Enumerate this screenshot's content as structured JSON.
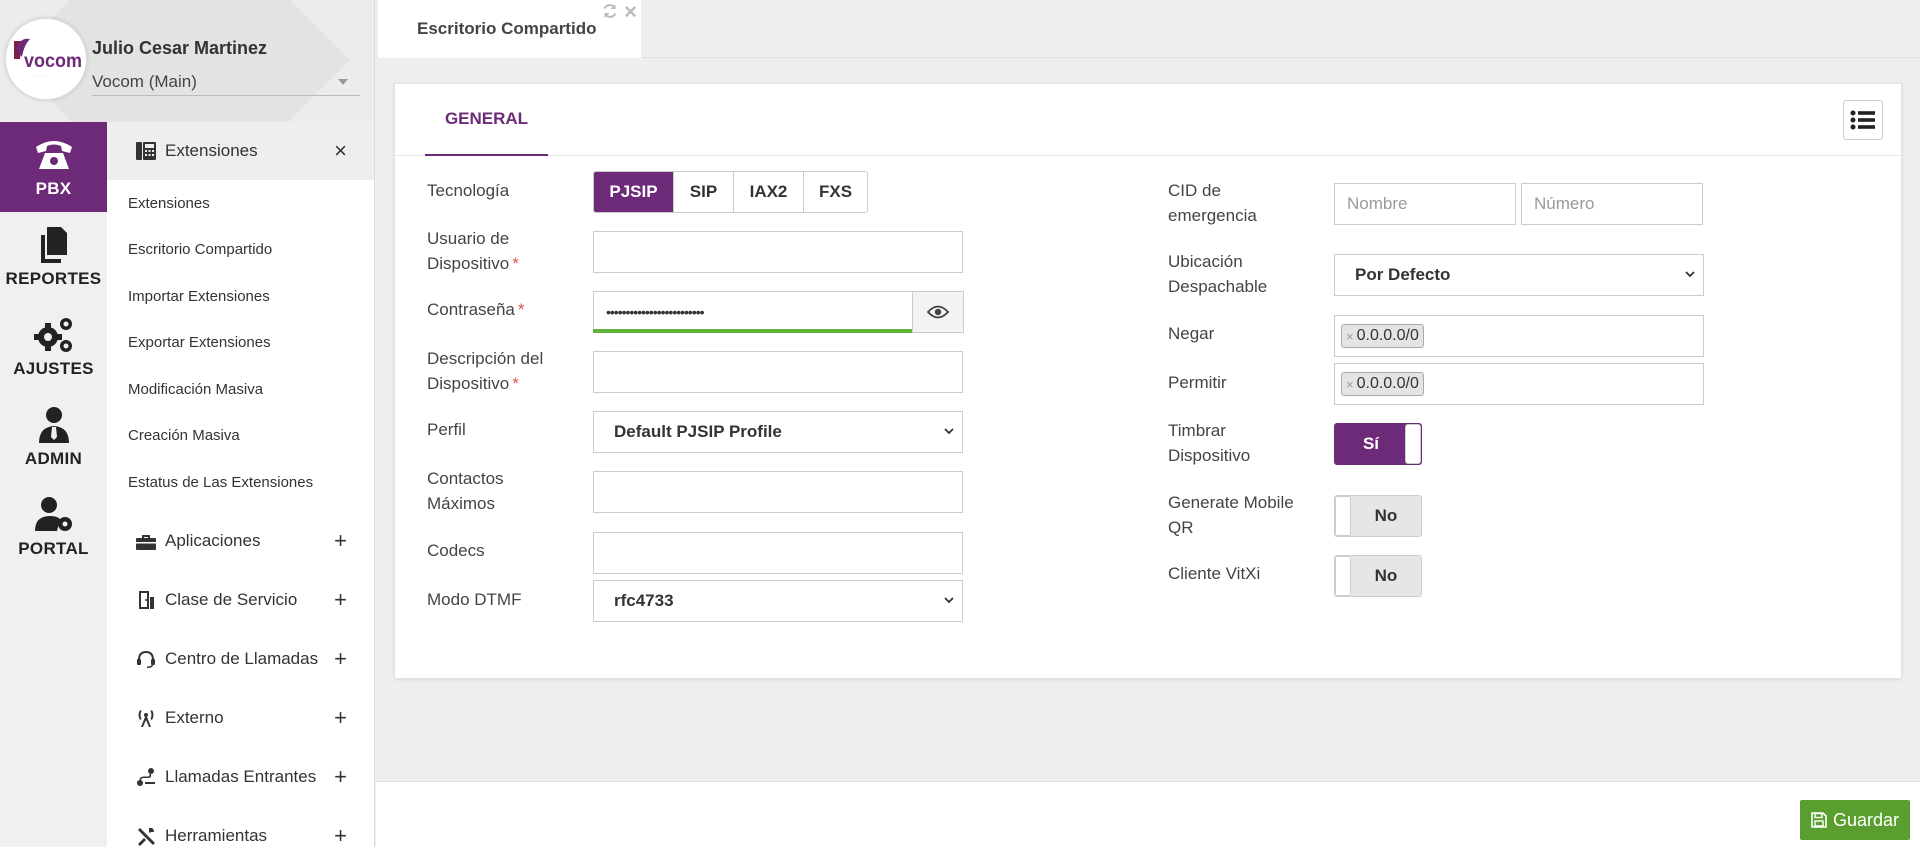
{
  "user": {
    "name": "Julio Cesar Martinez",
    "tenant": "Vocom (Main)",
    "logo_text": "vocom"
  },
  "rail": [
    {
      "label": "PBX",
      "icon": "phone-icon",
      "active": true
    },
    {
      "label": "REPORTES",
      "icon": "documents-icon",
      "active": false
    },
    {
      "label": "AJUSTES",
      "icon": "gears-icon",
      "active": false
    },
    {
      "label": "ADMIN",
      "icon": "admin-user-icon",
      "active": false
    },
    {
      "label": "PORTAL",
      "icon": "user-gear-icon",
      "active": false
    }
  ],
  "submenu": {
    "open_group": {
      "label": "Extensiones",
      "icon": "pbx-extension-icon",
      "toggle": "×"
    },
    "links": [
      "Extensiones",
      "Escritorio Compartido",
      "Importar Extensiones",
      "Exportar Extensiones",
      "Modificación Masiva",
      "Creación Masiva",
      "Estatus de Las Extensiones"
    ],
    "groups": [
      {
        "label": "Aplicaciones",
        "icon": "toolbox-icon",
        "toggle": "+"
      },
      {
        "label": "Clase de Servicio",
        "icon": "door-icon",
        "toggle": "+"
      },
      {
        "label": "Centro de Llamadas",
        "icon": "headset-icon",
        "toggle": "+"
      },
      {
        "label": "Externo",
        "icon": "antenna-icon",
        "toggle": "+"
      },
      {
        "label": "Llamadas Entrantes",
        "icon": "route-icon",
        "toggle": "+"
      },
      {
        "label": "Herramientas",
        "icon": "tools-icon",
        "toggle": "+"
      }
    ]
  },
  "tabbar": {
    "active_tab": "Escritorio Compartido",
    "close": "×"
  },
  "card": {
    "tab": "GENERAL",
    "left": {
      "tecnologia_label": "Tecnología",
      "tecnologia_options": [
        "PJSIP",
        "SIP",
        "IAX2",
        "FXS"
      ],
      "tecnologia_selected": "PJSIP",
      "usuario_label_1": "Usuario de",
      "usuario_label_2": "Dispositivo",
      "usuario_value": "",
      "contrasena_label": "Contraseña",
      "contrasena_value": "•••••••••••••••••••••••••",
      "descripcion_label_1": "Descripción del",
      "descripcion_label_2": "Dispositivo",
      "descripcion_value": "",
      "perfil_label": "Perfil",
      "perfil_value": "Default PJSIP Profile",
      "contactos_label_1": "Contactos",
      "contactos_label_2": "Máximos",
      "contactos_value": "",
      "codecs_label": "Codecs",
      "codecs_value": "",
      "dtmf_label": "Modo DTMF",
      "dtmf_value": "rfc4733",
      "required_mark": "*"
    },
    "right": {
      "cid_label_1": "CID de",
      "cid_label_2": "emergencia",
      "cid_nombre_placeholder": "Nombre",
      "cid_numero_placeholder": "Número",
      "ubicacion_label_1": "Ubicación",
      "ubicacion_label_2": "Despachable",
      "ubicacion_value": "Por Defecto",
      "negar_label": "Negar",
      "negar_tag": "0.0.0.0/0",
      "permitir_label": "Permitir",
      "permitir_tag": "0.0.0.0/0",
      "tag_remove": "×",
      "timbrar_label_1": "Timbrar",
      "timbrar_label_2": "Dispositivo",
      "timbrar_value": "Sí",
      "qr_label_1": "Generate Mobile",
      "qr_label_2": "QR",
      "qr_value": "No",
      "vitxi_label": "Cliente VitXi",
      "vitxi_value": "No"
    }
  },
  "footer": {
    "save_label": "Guardar"
  },
  "colors": {
    "accent": "#6d2a78",
    "save": "#5a9e2f",
    "password_strength": "#5fb336"
  }
}
